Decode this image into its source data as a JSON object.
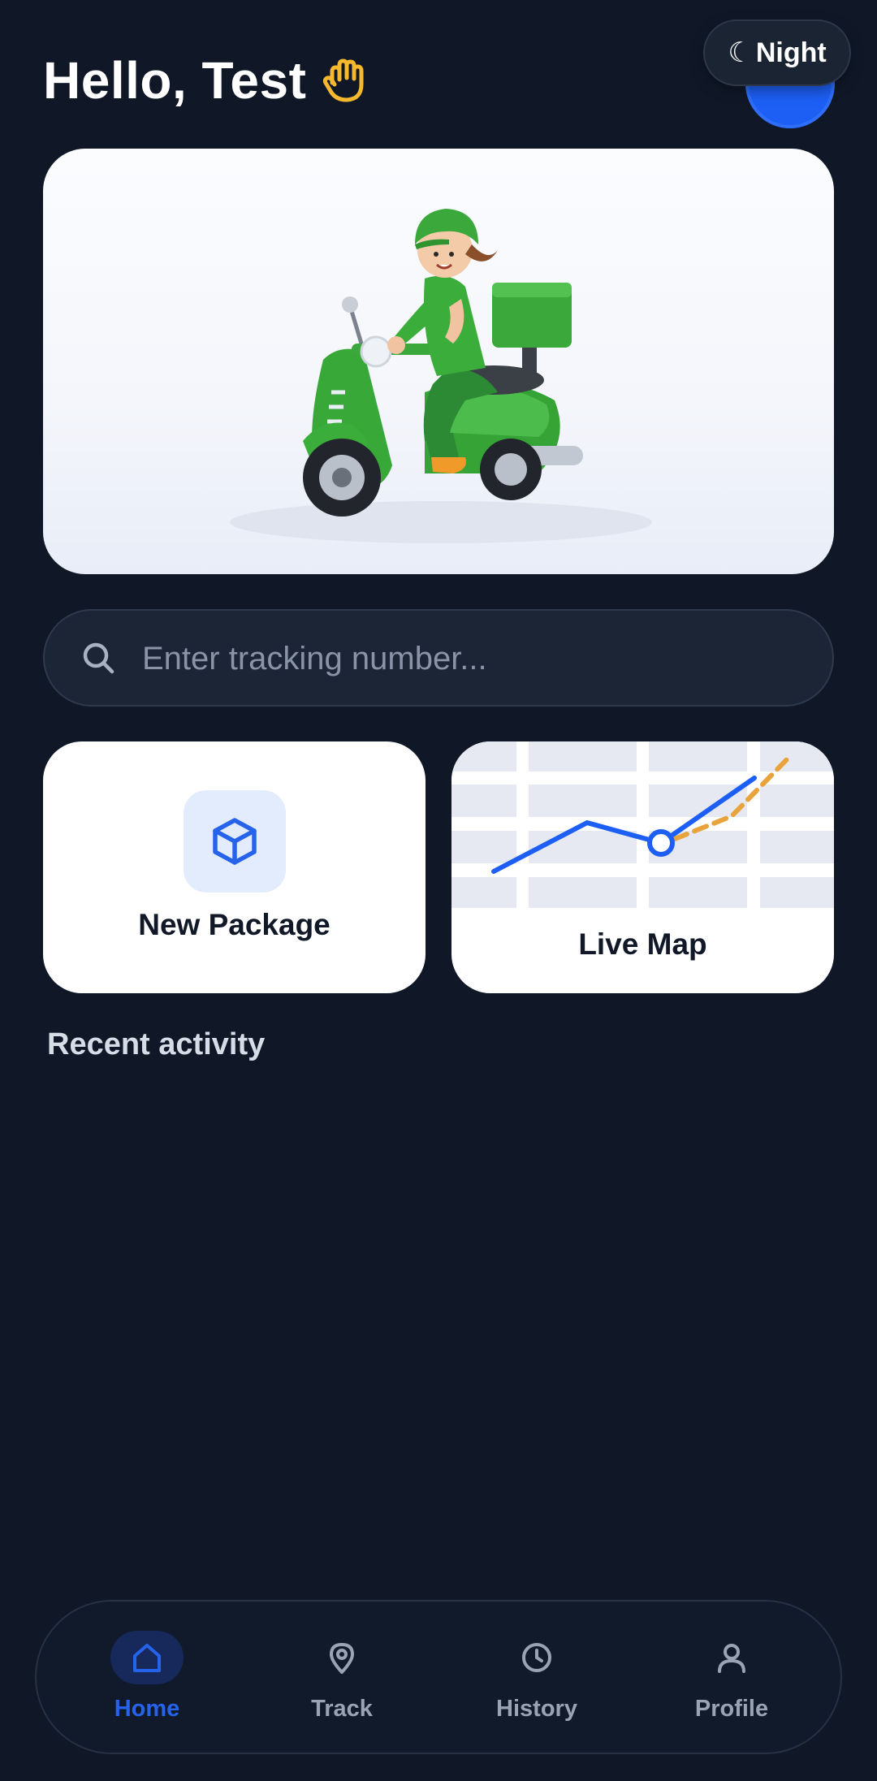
{
  "header": {
    "greeting": "Hello, Test",
    "theme_toggle_label": "Night",
    "theme_toggle_symbol": "☾"
  },
  "hero": {
    "illustration": "scooter-delivery-rider-illustration"
  },
  "search": {
    "placeholder": "Enter tracking number...",
    "value": ""
  },
  "actions": [
    {
      "label": "New Package",
      "icon": "package-icon"
    },
    {
      "label": "Live Map",
      "icon": "map-route-icon"
    }
  ],
  "recent": {
    "title": "Recent activity"
  },
  "nav": {
    "items": [
      {
        "label": "Home",
        "icon": "home-icon",
        "active": true
      },
      {
        "label": "Track",
        "icon": "location-pin-icon",
        "active": false
      },
      {
        "label": "History",
        "icon": "clock-icon",
        "active": false
      },
      {
        "label": "Profile",
        "icon": "user-icon",
        "active": false
      }
    ]
  },
  "colors": {
    "background": "#101828",
    "accent": "#1d5ff5",
    "route_dashed": "#e8a33d",
    "wave": "#f5b82e"
  }
}
